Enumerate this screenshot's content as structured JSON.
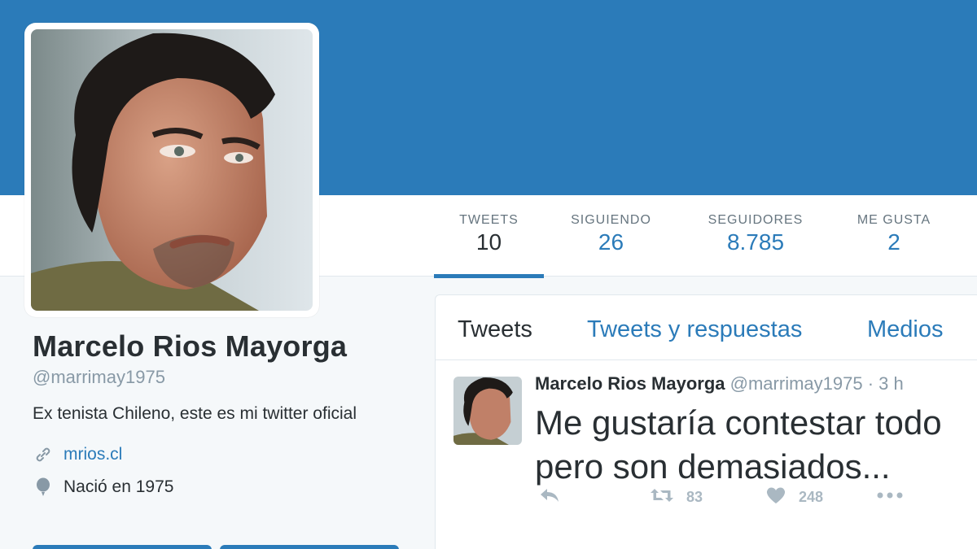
{
  "colors": {
    "brand": "#2b7bb9",
    "muted": "#8899a6",
    "icon": "#aab8c2"
  },
  "profile": {
    "name": "Marcelo Rios Mayorga",
    "handle": "@marrimay1975",
    "bio": "Ex tenista Chileno, este es mi twitter oficial",
    "website": "mrios.cl",
    "birth": "Nació en 1975"
  },
  "stats": [
    {
      "label": "TWEETS",
      "value": "10"
    },
    {
      "label": "SIGUIENDO",
      "value": "26"
    },
    {
      "label": "SEGUIDORES",
      "value": "8.785"
    },
    {
      "label": "ME GUSTA",
      "value": "2"
    }
  ],
  "tabs": [
    {
      "label": "Tweets"
    },
    {
      "label": "Tweets y respuestas"
    },
    {
      "label": "Medios"
    }
  ],
  "tweet": {
    "name": "Marcelo Rios Mayorga",
    "handle": "@marrimay1975",
    "time": "· 3 h",
    "line1": "Me gustaría contestar todo",
    "line2": "pero son demasiados...",
    "retweets": "83",
    "likes": "248"
  },
  "icons": [
    "link-icon",
    "balloon-icon",
    "reply-icon",
    "retweet-icon",
    "heart-icon",
    "more-icon"
  ]
}
